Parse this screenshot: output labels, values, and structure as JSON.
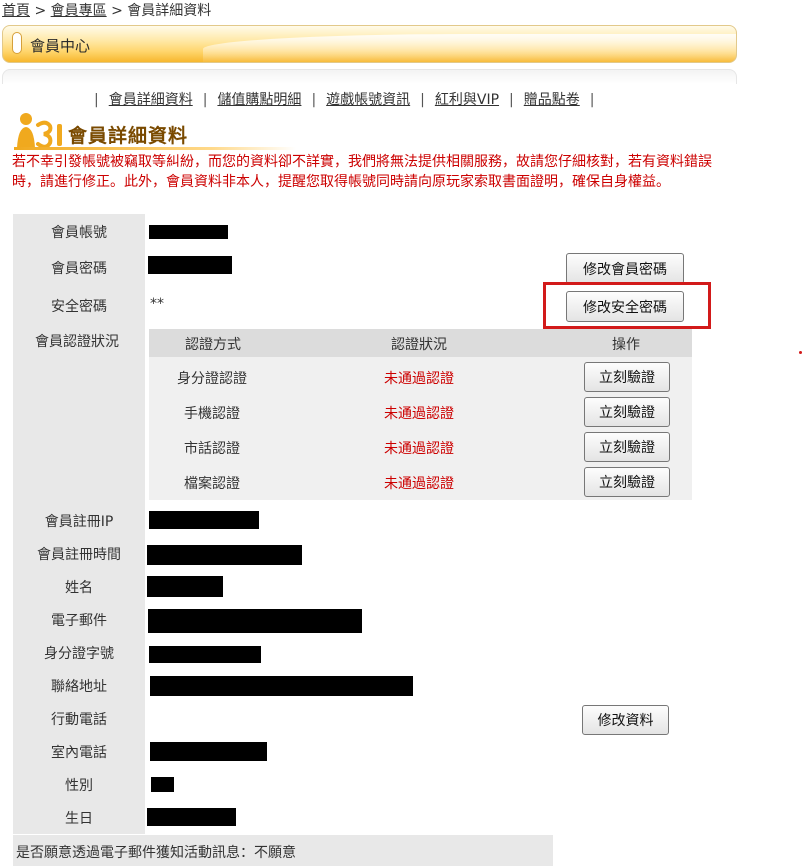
{
  "breadcrumb": {
    "home": "首頁",
    "zone": "會員專區",
    "current": "會員詳細資料",
    "sep": " > "
  },
  "header": {
    "title": "會員中心"
  },
  "tabs": [
    {
      "label": "會員詳細資料"
    },
    {
      "label": "儲值購點明細"
    },
    {
      "label": "遊戲帳號資訊"
    },
    {
      "label": "紅利與VIP"
    },
    {
      "label": "贈品點卷"
    }
  ],
  "tab_separator": "|",
  "section": {
    "title": "會員詳細資料"
  },
  "notice": "若不幸引發帳號被竊取等糾紛，而您的資料卻不詳實，我們將無法提供相關服務，故請您仔細核對，若有資料錯誤時，請進行修正。此外，會員資料非本人，提醒您取得帳號同時請向原玩家索取書面證明，確保自身權益。",
  "fields": {
    "account": "會員帳號",
    "password": "會員密碼",
    "security_password": "安全密碼",
    "security_password_value": "**",
    "auth_status": "會員認證狀況",
    "reg_ip": "會員註冊IP",
    "reg_time": "會員註冊時間",
    "name": "姓名",
    "email": "電子郵件",
    "id_number": "身分證字號",
    "address": "聯絡地址",
    "mobile": "行動電話",
    "phone": "室內電話",
    "gender": "性別",
    "birthday": "生日"
  },
  "buttons": {
    "change_password": "修改會員密碼",
    "change_security_password": "修改安全密碼",
    "edit_profile": "修改資料"
  },
  "auth_table": {
    "headers": [
      "認證方式",
      "認證狀況",
      "操作"
    ],
    "rows": [
      {
        "method": "身分證認證",
        "status": "未通過認證",
        "action": "立刻驗證"
      },
      {
        "method": "手機認證",
        "status": "未通過認證",
        "action": "立刻驗證"
      },
      {
        "method": "市話認證",
        "status": "未通過認證",
        "action": "立刻驗證"
      },
      {
        "method": "檔案認證",
        "status": "未通過認證",
        "action": "立刻驗證"
      }
    ]
  },
  "newsletter": "是否願意透過電子郵件獲知活動訊息：不願意",
  "colors": {
    "accent": "#f7b72e",
    "alert": "#cc0000",
    "highlight": "#d21a1a"
  },
  "icons": {
    "section": "member-person-icon"
  }
}
